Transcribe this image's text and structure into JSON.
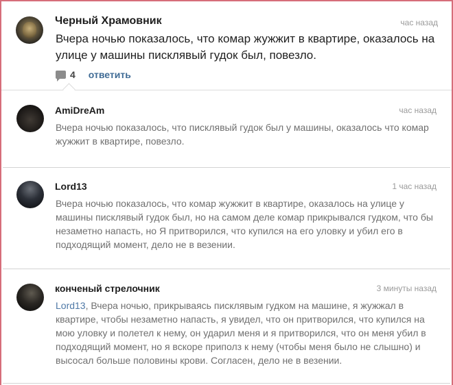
{
  "main_comment": {
    "author": "Черный Храмовник",
    "time": "час назад",
    "text": "Вчера ночью показалось, что комар жужжит в квартире, оказалось на улице у машины писклявый гудок был, повезло.",
    "replies_count": "4",
    "reply_label": "ответить",
    "comment_icon": "comment-icon"
  },
  "replies": [
    {
      "author": "AmiDreAm",
      "time": "час назад",
      "text": "Вчера ночью показалось, что писклявый гудок был у машины, оказалось что комар жужжит в квартире, повезло."
    },
    {
      "author": "Lord13",
      "time": "1 час назад",
      "text": "Вчера ночью показалось, что комар жужжит в квартире, оказалось на улице у машины писклявый гудок был, но на самом деле комар прикрывался гудком, что бы незаметно напасть, но Я притворился, что купился на его уловку и убил его в подходящий момент, дело не в везении."
    },
    {
      "author": "конченый стрелочник",
      "time": "3 минуты назад",
      "mention": "Lord13",
      "text": ", Вчера ночью, прикрываясь писклявым гудком на машине, я жужжал в квартире, чтобы незаметно напасть, я увидел, что он притворился, что купился на мою уловку и полетел к нему, он ударил меня и я притворился, что он меня убил в подходящий момент, но я вскоре приполз к нему (чтобы меня было не слышно) и высосал больше половины крови. Согласен, дело не в везении."
    }
  ],
  "colors": {
    "frame": "#d66d7a",
    "link": "#3f6b95",
    "mention": "#4e78a6"
  }
}
